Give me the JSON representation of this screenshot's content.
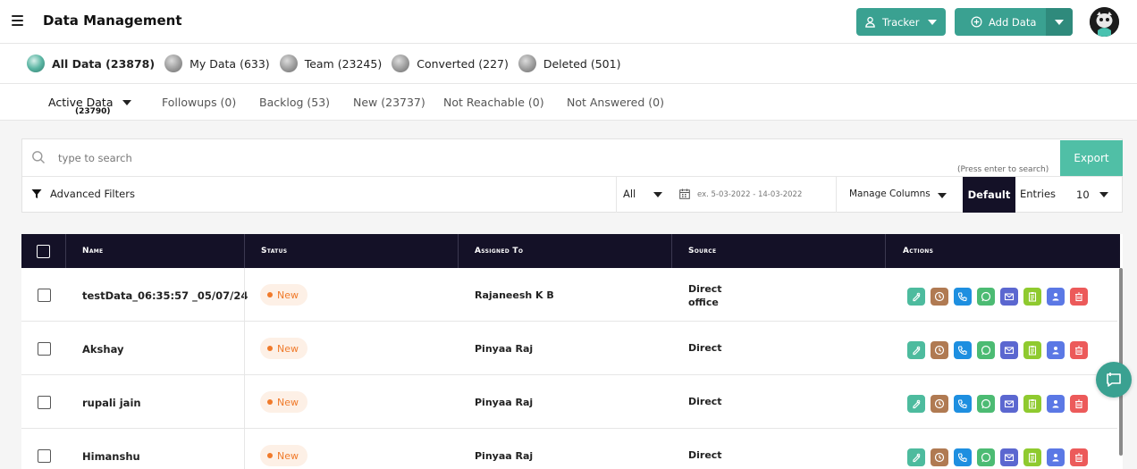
{
  "header": {
    "title": "Data Management",
    "tracker_label": "Tracker",
    "add_data_label": "Add Data"
  },
  "data_types": [
    {
      "label": "All Data (23878)",
      "active": true
    },
    {
      "label": "My Data (633)"
    },
    {
      "label": "Team (23245)"
    },
    {
      "label": "Converted (227)"
    },
    {
      "label": "Deleted (501)"
    }
  ],
  "subtabs": {
    "active_label": "Active Data",
    "active_count": "(23790)",
    "items": [
      "Followups (0)",
      "Backlog (53)",
      "New (23737)",
      "Not Reachable (0)",
      "Not Answered (0)"
    ]
  },
  "search": {
    "placeholder": "type to search",
    "hint": "(Press enter to search)",
    "export_label": "Export"
  },
  "filters": {
    "advanced_label": "Advanced Filters",
    "all_label": "All",
    "date_placeholder": "ex. 5-03-2022 - 14-03-2022",
    "manage_columns_label": "Manage Columns",
    "default_label": "Default",
    "entries_label": "Entries",
    "entries_value": "10"
  },
  "table": {
    "columns": [
      "Name",
      "Status",
      "Assigned To",
      "Source",
      "Actions"
    ],
    "rows": [
      {
        "name": "testData_06:35:57 _05/07/24",
        "status": "New",
        "assigned": "Rajaneesh K B",
        "source": "Direct",
        "source_sub": "office"
      },
      {
        "name": "Akshay",
        "status": "New",
        "assigned": "Pinyaa Raj",
        "source": "Direct",
        "source_sub": ""
      },
      {
        "name": "rupali jain",
        "status": "New",
        "assigned": "Pinyaa Raj",
        "source": "Direct",
        "source_sub": ""
      },
      {
        "name": "Himanshu",
        "status": "New",
        "assigned": "Pinyaa Raj",
        "source": "Direct",
        "source_sub": ""
      }
    ]
  },
  "action_icons": [
    {
      "name": "edit-icon",
      "color": "#4dbb9e"
    },
    {
      "name": "history-icon",
      "color": "#b07a52"
    },
    {
      "name": "phone-icon",
      "color": "#1e8fe0"
    },
    {
      "name": "whatsapp-icon",
      "color": "#4cbb73"
    },
    {
      "name": "mail-icon",
      "color": "#5b67d0"
    },
    {
      "name": "clipboard-icon",
      "color": "#8fca2f"
    },
    {
      "name": "users-icon",
      "color": "#5b78e5"
    },
    {
      "name": "delete-icon",
      "color": "#ec5a5a"
    }
  ],
  "colors": {
    "accent": "#3aa191",
    "header_dark": "#141127",
    "badge_new": "#f07a2a"
  }
}
